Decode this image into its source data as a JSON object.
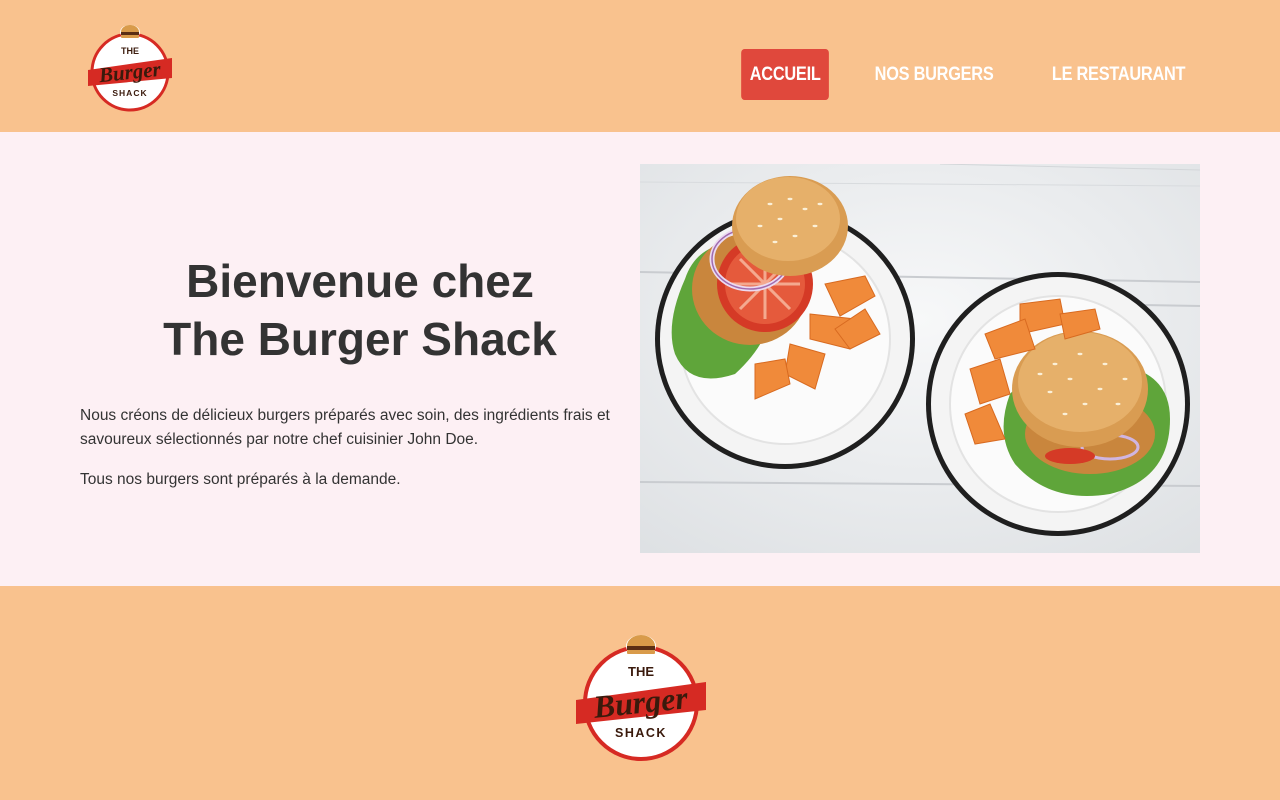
{
  "brand": {
    "logo_line1": "THE",
    "logo_line2": "Burger",
    "logo_line3": "SHACK",
    "colors": {
      "header_bg": "#f9c28e",
      "accent": "#e0483c",
      "logo_red": "#d62a23",
      "text": "#333333",
      "page_bg": "#fdf0f4"
    }
  },
  "nav": {
    "items": [
      {
        "label": "ACCUEIL",
        "active": true
      },
      {
        "label": "NOS BURGERS",
        "active": false
      },
      {
        "label": "LE RESTAURANT",
        "active": false
      }
    ]
  },
  "hero": {
    "title_line1": "Bienvenue chez",
    "title_line2": "The Burger Shack",
    "paragraph1": "Nous créons de délicieux burgers préparés avec soin, des ingrédients frais et savoureux sélectionnés par notre chef cuisinier John Doe.",
    "paragraph2": "Tous nos burgers sont préparés à la demande.",
    "image_icon": "burgers-photo"
  }
}
